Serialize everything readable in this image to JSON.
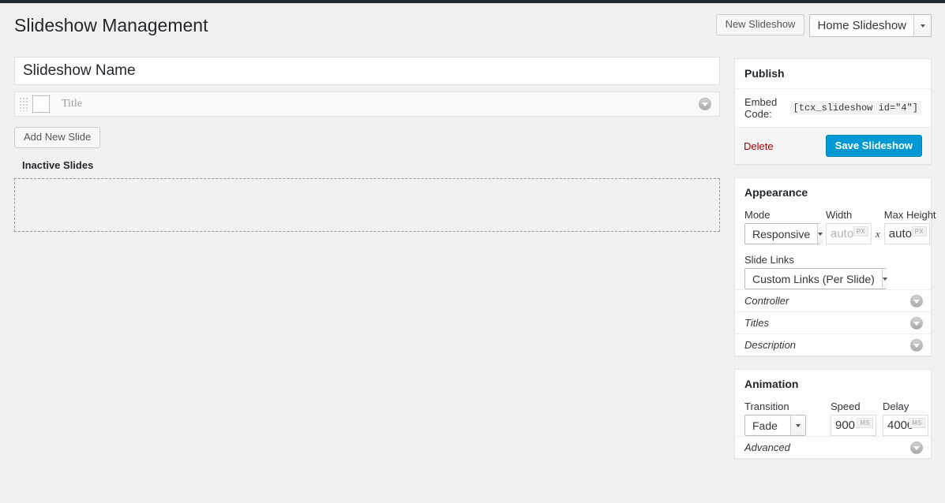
{
  "header": {
    "title": "Slideshow Management",
    "new_slideshow_label": "New Slideshow",
    "slideshow_select_value": "Home Slideshow"
  },
  "main": {
    "slideshow_name_value": "Slideshow Name",
    "slideshow_name_placeholder": "Slideshow Name",
    "slides": [
      {
        "title": "Title"
      }
    ],
    "add_new_slide_label": "Add New Slide",
    "inactive_slides_heading": "Inactive Slides"
  },
  "sidebar": {
    "publish": {
      "title": "Publish",
      "embed_label": "Embed Code:",
      "embed_code": "[tcx_slideshow id=\"4\"]",
      "delete_label": "Delete",
      "save_label": "Save Slideshow"
    },
    "appearance": {
      "title": "Appearance",
      "mode_label": "Mode",
      "mode_value": "Responsive",
      "width_label": "Width",
      "width_value": "",
      "width_placeholder": "auto",
      "width_unit": "PX",
      "separator": "x",
      "max_height_label": "Max Height",
      "max_height_value": "auto",
      "max_height_unit": "PX",
      "slide_links_label": "Slide Links",
      "slide_links_value": "Custom Links (Per Slide)",
      "sections": [
        {
          "label": "Controller"
        },
        {
          "label": "Titles"
        },
        {
          "label": "Description"
        }
      ]
    },
    "animation": {
      "title": "Animation",
      "transition_label": "Transition",
      "transition_value": "Fade",
      "speed_label": "Speed",
      "speed_value": "900",
      "speed_unit": "MS",
      "delay_label": "Delay",
      "delay_value": "4000",
      "delay_unit": "MS",
      "sections": [
        {
          "label": "Advanced"
        }
      ]
    }
  },
  "colors": {
    "accent": "#0099d5",
    "delete": "#aa0000",
    "page_bg": "#f1f1f1",
    "admin_bar": "#23282d"
  }
}
